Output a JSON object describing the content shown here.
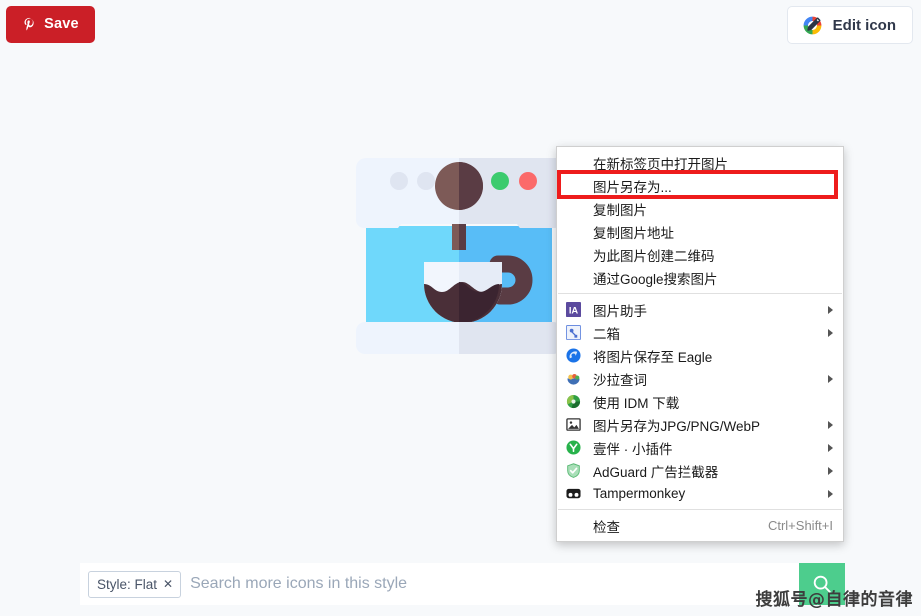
{
  "page": {
    "background_color": "#f7f9fb"
  },
  "toolbar": {
    "save_button": {
      "label": "Save",
      "icon": "pinterest-p-icon",
      "color": "#cb1f27"
    },
    "edit_icon_button": {
      "label": "Edit icon",
      "icon": "pencil-circle-icon"
    }
  },
  "preview": {
    "icon_name": "coffee-machine-flat-icon",
    "colors": {
      "body_light": "#eef4fd",
      "body_shade": "#e0e5f0",
      "panel_left": "#6fd8fb",
      "panel_right": "#58bdf7",
      "coffee_dark": "#4a2f38",
      "coffee_mid": "#7d5a57",
      "dot_green": "#3ccb6e",
      "dot_red": "#fb6a6a",
      "dot_gray": "#dfe5f1",
      "cup": "#f2f6fd"
    }
  },
  "context_menu": {
    "groups": [
      {
        "name": "image-actions",
        "items": [
          {
            "label": "在新标签页中打开图片",
            "icon": null,
            "submenu": false,
            "shortcut": null,
            "highlighted": false
          },
          {
            "label": "图片另存为...",
            "icon": null,
            "submenu": false,
            "shortcut": null,
            "highlighted": true
          },
          {
            "label": "复制图片",
            "icon": null,
            "submenu": false,
            "shortcut": null,
            "highlighted": false
          },
          {
            "label": "复制图片地址",
            "icon": null,
            "submenu": false,
            "shortcut": null,
            "highlighted": false
          },
          {
            "label": "为此图片创建二维码",
            "icon": null,
            "submenu": false,
            "shortcut": null,
            "highlighted": false
          },
          {
            "label": "通过Google搜索图片",
            "icon": null,
            "submenu": false,
            "shortcut": null,
            "highlighted": false
          }
        ]
      },
      {
        "name": "extensions",
        "items": [
          {
            "label": "图片助手",
            "icon": "image-assistant-ia-icon",
            "submenu": true,
            "shortcut": null,
            "highlighted": false
          },
          {
            "label": "二箱",
            "icon": "erxiang-icon",
            "submenu": true,
            "shortcut": null,
            "highlighted": false
          },
          {
            "label": "将图片保存至 Eagle",
            "icon": "eagle-icon",
            "submenu": false,
            "shortcut": null,
            "highlighted": false
          },
          {
            "label": "沙拉查词",
            "icon": "saladict-bowl-icon",
            "submenu": true,
            "shortcut": null,
            "highlighted": false
          },
          {
            "label": "使用 IDM 下载",
            "icon": "idm-globe-icon",
            "submenu": false,
            "shortcut": null,
            "highlighted": false
          },
          {
            "label": "图片另存为JPG/PNG/WebP",
            "icon": "image-frame-icon",
            "submenu": true,
            "shortcut": null,
            "highlighted": false
          },
          {
            "label": "壹伴 · 小插件",
            "icon": "yiban-icon",
            "submenu": true,
            "shortcut": null,
            "highlighted": false
          },
          {
            "label": "AdGuard 广告拦截器",
            "icon": "adguard-shield-icon",
            "submenu": true,
            "shortcut": null,
            "highlighted": false
          },
          {
            "label": "Tampermonkey",
            "icon": "tampermonkey-icon",
            "submenu": true,
            "shortcut": null,
            "highlighted": false
          }
        ]
      },
      {
        "name": "inspect",
        "items": [
          {
            "label": "检查",
            "icon": null,
            "submenu": false,
            "shortcut": "Ctrl+Shift+I",
            "highlighted": false
          }
        ]
      }
    ],
    "highlight_color": "#ee1c1c"
  },
  "search": {
    "chip_label": "Style: Flat",
    "chip_close": "✕",
    "placeholder": "Search more icons in this style",
    "value": "",
    "submit_icon": "search-icon",
    "submit_color": "#4dcd8d"
  },
  "watermark": {
    "text": "搜狐号@自律的音律"
  }
}
